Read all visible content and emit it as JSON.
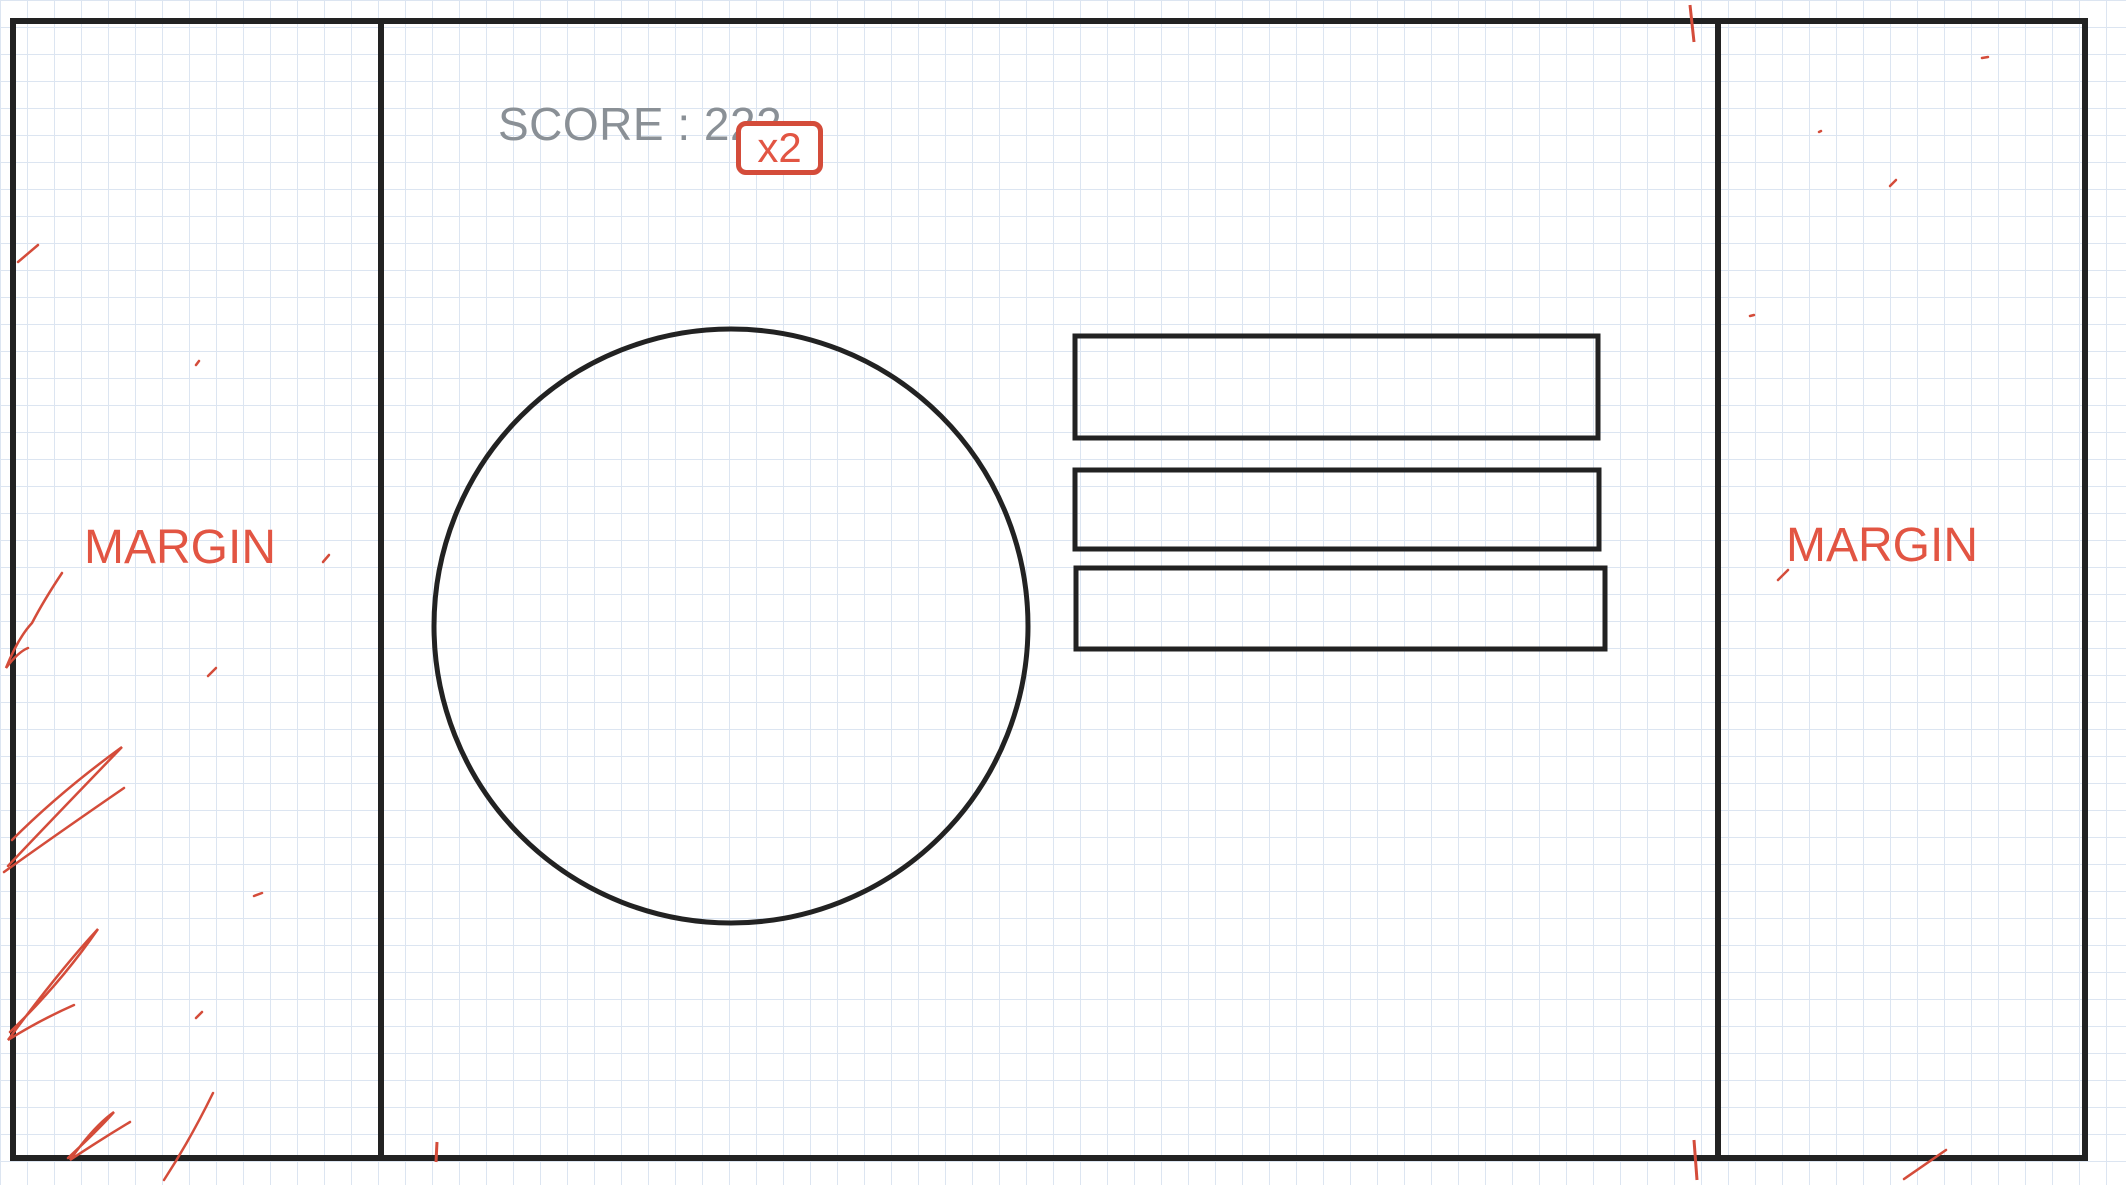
{
  "score": {
    "text": "SCORE : 222",
    "multiplier": "x2"
  },
  "margins": {
    "left_label": "MARGIN",
    "right_label": "MARGIN"
  },
  "colors": {
    "outline": "#222222",
    "annotation_red": "#e25543",
    "score_gray": "#8a9096",
    "grid": "#dce5f1"
  },
  "elements": {
    "play_area": "circle",
    "menu_bars": 3
  }
}
